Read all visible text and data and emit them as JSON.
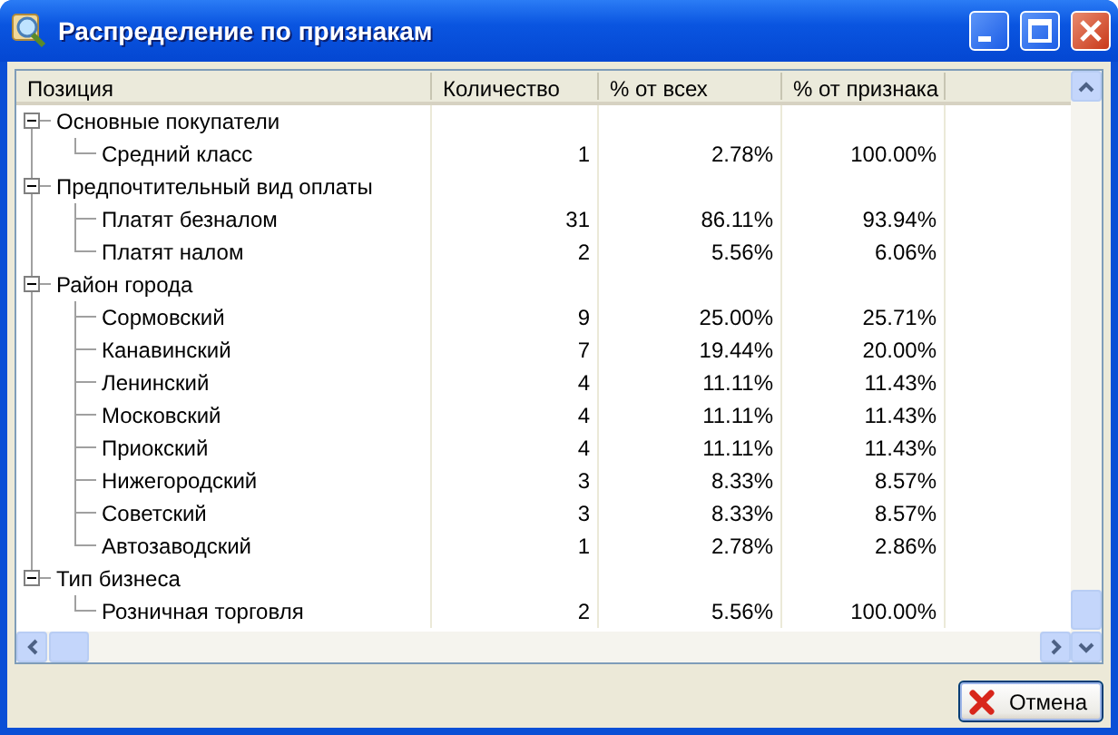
{
  "window": {
    "title": "Распределение по признакам"
  },
  "table": {
    "columns": [
      "Позиция",
      "Количество",
      "% от всех",
      "% от признака"
    ],
    "groups": [
      {
        "label": "Основные покупатели",
        "expanded": true,
        "children": [
          {
            "cells": [
              "Средний класс",
              "1",
              "2.78%",
              "100.00%"
            ]
          }
        ]
      },
      {
        "label": "Предпочтительный вид оплаты",
        "expanded": true,
        "children": [
          {
            "cells": [
              "Платят безналом",
              "31",
              "86.11%",
              "93.94%"
            ]
          },
          {
            "cells": [
              "Платят налом",
              "2",
              "5.56%",
              "6.06%"
            ]
          }
        ]
      },
      {
        "label": "Район города",
        "expanded": true,
        "children": [
          {
            "cells": [
              "Сормовский",
              "9",
              "25.00%",
              "25.71%"
            ]
          },
          {
            "cells": [
              "Канавинский",
              "7",
              "19.44%",
              "20.00%"
            ]
          },
          {
            "cells": [
              "Ленинский",
              "4",
              "11.11%",
              "11.43%"
            ]
          },
          {
            "cells": [
              "Московский",
              "4",
              "11.11%",
              "11.43%"
            ]
          },
          {
            "cells": [
              "Приокский",
              "4",
              "11.11%",
              "11.43%"
            ]
          },
          {
            "cells": [
              "Нижегородский",
              "3",
              "8.33%",
              "8.57%"
            ]
          },
          {
            "cells": [
              "Советский",
              "3",
              "8.33%",
              "8.57%"
            ]
          },
          {
            "cells": [
              "Автозаводский",
              "1",
              "2.78%",
              "2.86%"
            ]
          }
        ]
      },
      {
        "label": "Тип бизнеса",
        "expanded": true,
        "children": [
          {
            "cells": [
              "Розничная торговля",
              "2",
              "5.56%",
              "100.00%"
            ]
          }
        ]
      }
    ]
  },
  "buttons": [
    {
      "label": "Отмена",
      "kind": "cancel"
    }
  ]
}
